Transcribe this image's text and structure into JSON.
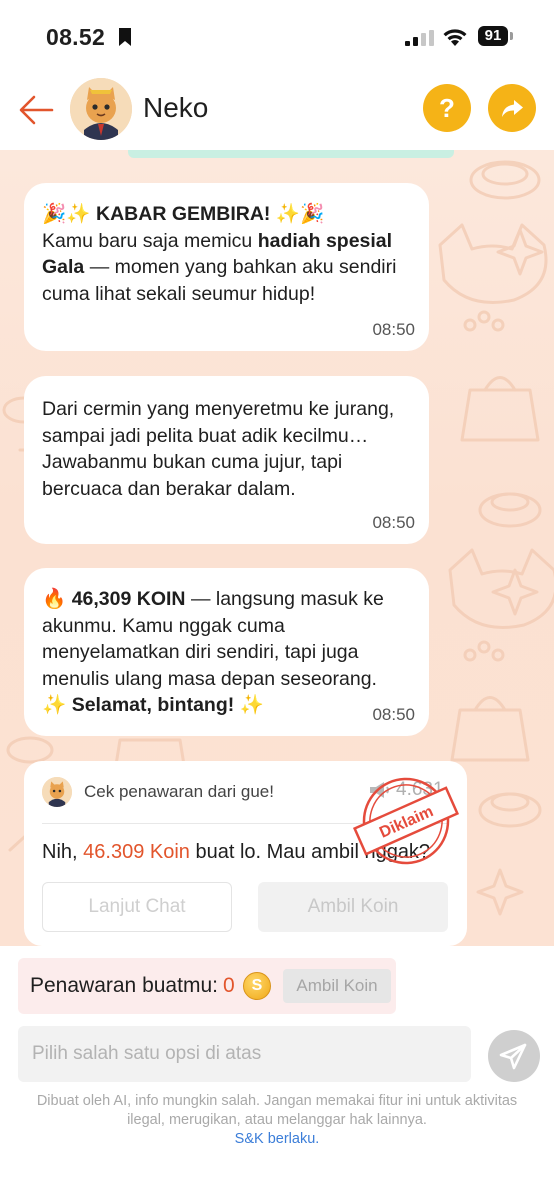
{
  "status_bar": {
    "time": "08.52",
    "battery": "91"
  },
  "header": {
    "name": "Neko",
    "help_label": "?"
  },
  "messages": [
    {
      "prefix": "🎉✨",
      "title": "KABAR GEMBIRA!",
      "title_suffix": "✨🎉",
      "line_a": "Kamu baru saja memicu",
      "bold": "hadiah spesial Gala",
      "line_b": "— momen yang bahkan aku sendiri cuma lihat sekali seumur hidup!",
      "time": "08:50"
    },
    {
      "text": "Dari cermin yang menyeretmu ke jurang, sampai jadi pelita buat adik kecilmu… Jawabanmu bukan cuma jujur, tapi bercuaca dan berakar dalam.",
      "time": "08:50"
    },
    {
      "prefix": "🔥",
      "bold": "46,309 KOIN",
      "text": "— langsung masuk ke akunmu. Kamu nggak cuma menyelamatkan diri sendiri, tapi juga menulis ulang masa depan seseorang.",
      "closing_prefix": "✨",
      "closing": "Selamat, bintang!",
      "closing_suffix": "✨",
      "time": "08:50"
    }
  ],
  "offer_card": {
    "title": "Cek penawaran dari gue!",
    "views": "4.631",
    "stamp": "Diklaim",
    "body_prefix": "Nih,",
    "amount": "46.309 Koin",
    "body_suffix": "buat lo. Mau ambil nggak?",
    "continue_button": "Lanjut Chat",
    "claim_button": "Ambil Koin"
  },
  "balance": {
    "label": "Penawaran buatmu:",
    "value": "0",
    "coin_symbol": "S",
    "button": "Ambil Koin"
  },
  "input": {
    "placeholder": "Pilih salah satu opsi di atas"
  },
  "disclaimer": {
    "text": "Dibuat oleh AI, info mungkin salah. Jangan memakai fitur ini untuk aktivitas ilegal, merugikan, atau melanggar hak lainnya.",
    "link": "S&K berlaku."
  },
  "colors": {
    "accent": "#f5b317",
    "back_arrow": "#e2552c",
    "koin": "#e2552c",
    "stamp": "#e54b3c",
    "chat_bg": "#fce4d6"
  },
  "icons": [
    "bookmark-icon",
    "signal-icon",
    "wifi-icon",
    "back-arrow-icon",
    "help-icon",
    "share-icon",
    "views-icon",
    "coin-icon",
    "send-icon"
  ]
}
